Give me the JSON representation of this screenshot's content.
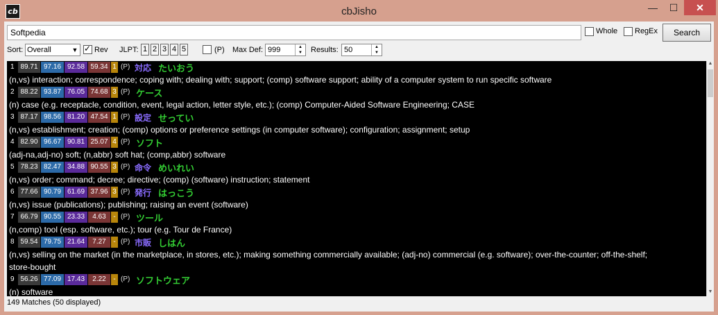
{
  "window": {
    "title": "cbJisho",
    "icon_text": "cb",
    "min": "—",
    "max": "☐",
    "close": "✕"
  },
  "search": {
    "value": "Softpedia",
    "whole_label": "Whole",
    "regex_label": "RegEx",
    "button": "Search"
  },
  "options": {
    "sort_label": "Sort:",
    "sort_value": "Overall",
    "rev_label": "Rev",
    "rev_checked": true,
    "jlpt_label": "JLPT:",
    "jlpt_buttons": [
      "1",
      "2",
      "3",
      "4",
      "5"
    ],
    "p_label": "(P)",
    "maxdef_label": "Max Def:",
    "maxdef_value": "999",
    "results_label": "Results:",
    "results_value": "50"
  },
  "entries": [
    {
      "num": "1",
      "scores": [
        "89.71",
        "97.16",
        "92.58",
        "59.34",
        "1"
      ],
      "p": "(P)",
      "kanji": "対応",
      "kana": "たいおう",
      "def": "(n,vs) interaction; correspondence; coping with; dealing with; support; (comp) software support; ability of a computer system to run specific software"
    },
    {
      "num": "2",
      "scores": [
        "88.22",
        "93.87",
        "76.05",
        "74.68",
        "3"
      ],
      "p": "(P)",
      "kanji": "",
      "kana": "ケース",
      "def": "(n) case (e.g. receptacle, condition, event, legal action, letter style, etc.); (comp) Computer-Aided Software Engineering; CASE"
    },
    {
      "num": "3",
      "scores": [
        "87.17",
        "98.56",
        "81.20",
        "47.54",
        "1"
      ],
      "p": "(P)",
      "kanji": "設定",
      "kana": "せってい",
      "def": "(n,vs) establishment; creation; (comp) options or preference settings (in computer software); configuration; assignment; setup"
    },
    {
      "num": "4",
      "scores": [
        "82.90",
        "96.67",
        "90.81",
        "25.07",
        "4"
      ],
      "p": "(P)",
      "kanji": "",
      "kana": "ソフト",
      "def": "(adj-na,adj-no) soft; (n,abbr) soft hat; (comp,abbr) software"
    },
    {
      "num": "5",
      "scores": [
        "78.23",
        "82.47",
        "34.88",
        "90.55",
        "3"
      ],
      "p": "(P)",
      "kanji": "命令",
      "kana": "めいれい",
      "def": "(n,vs) order; command; decree; directive; (comp) (software) instruction; statement"
    },
    {
      "num": "6",
      "scores": [
        "77.66",
        "90.79",
        "61.69",
        "37.96",
        "3"
      ],
      "p": "(P)",
      "kanji": "発行",
      "kana": "はっこう",
      "def": "(n,vs) issue (publications); publishing; raising an event (software)"
    },
    {
      "num": "7",
      "scores": [
        "66.79",
        "90.55",
        "23.33",
        "4.63",
        "-"
      ],
      "p": "(P)",
      "kanji": "",
      "kana": "ツール",
      "def": "(n,comp) tool (esp. software, etc.); tour (e.g. Tour de France)"
    },
    {
      "num": "8",
      "scores": [
        "59.54",
        "79.75",
        "21.64",
        "7.27",
        "-"
      ],
      "p": "(P)",
      "kanji": "市販",
      "kana": "しはん",
      "def": "(n,vs) selling on the market (in the marketplace, in stores, etc.); making something commercially available; (adj-no) commercial (e.g. software); over-the-counter; off-the-shelf;",
      "def2": "store-bought"
    },
    {
      "num": "9",
      "scores": [
        "56.26",
        "77.09",
        "17.43",
        "2.22",
        "-"
      ],
      "p": "(P)",
      "kanji": "",
      "kana": "ソフトウェア",
      "def": "(n) software"
    }
  ],
  "status": "149 Matches (50 displayed)"
}
